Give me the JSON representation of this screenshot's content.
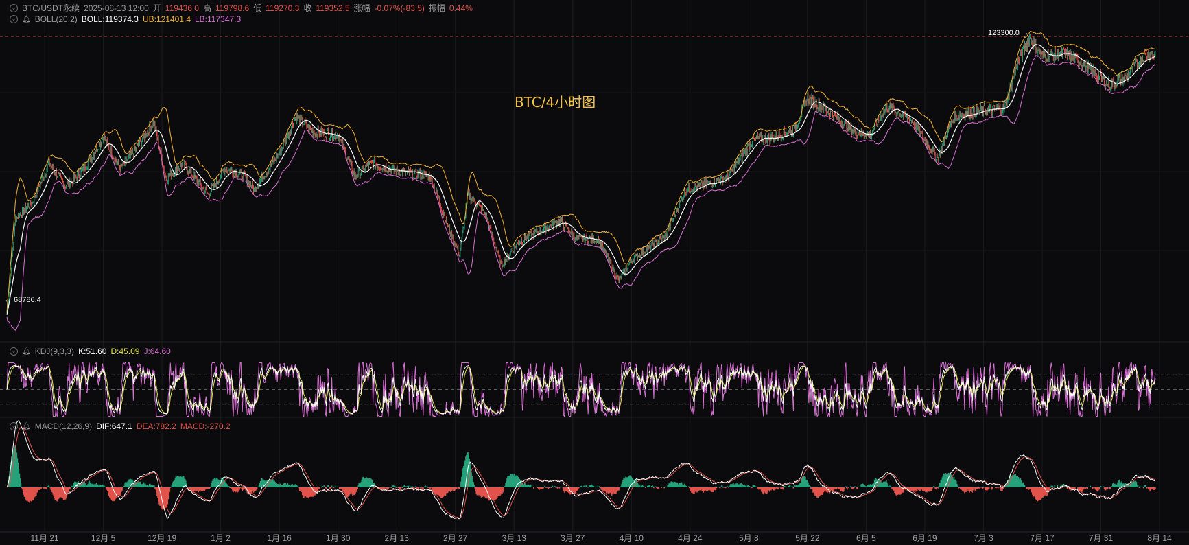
{
  "header": {
    "symbol": "BTC/USDT永续",
    "datetime": "2025-08-13 12:00",
    "open_label": "开",
    "open": "119436.0",
    "high_label": "高",
    "high": "119798.6",
    "low_label": "低",
    "low": "119270.3",
    "close_label": "收",
    "close": "119352.5",
    "change_label": "涨幅",
    "change": "-0.07%(-83.5)",
    "amp_label": "振幅",
    "amp": "0.44%"
  },
  "boll": {
    "name": "BOLL(20,2)",
    "mid": "BOLL:119374.3",
    "ub": "UB:121401.4",
    "lb": "LB:117347.3"
  },
  "kdj": {
    "name": "KDJ(9,3,3)",
    "k": "K:51.60",
    "d": "D:45.09",
    "j": "J:64.60"
  },
  "macd": {
    "name": "MACD(12,26,9)",
    "dif": "DIF:647.1",
    "dea": "DEA:782.2",
    "macd": "MACD:-270.2"
  },
  "annotations": {
    "title": "BTC/4小时图",
    "high_tag": "123300.0 →",
    "low_tag": "← 68786.4"
  },
  "colors": {
    "bg": "#0b0b0d",
    "up": "#26a17b",
    "down": "#e0534a",
    "boll_mid": "#ffffff",
    "boll_ub": "#f2b233",
    "boll_lb": "#d86fd3",
    "kdj_k": "#ffffff",
    "kdj_d": "#e6e34a",
    "kdj_j": "#d86fd3",
    "ref_line": "#e0534a"
  },
  "chart_data": {
    "type": "line",
    "xlabel": "",
    "ylabel": "",
    "x_ticks": [
      "11月 21",
      "12月 5",
      "12月 19",
      "1月 2",
      "1月 16",
      "1月 30",
      "2月 13",
      "2月 27",
      "3月 13",
      "3月 27",
      "4月 10",
      "4月 24",
      "5月 8",
      "5月 22",
      "6月 5",
      "6月 19",
      "7月 3",
      "7月 17",
      "7月 31",
      "8月 14"
    ],
    "price_extremes": {
      "high": 123300.0,
      "low": 68786.4
    },
    "reference_line": 122800,
    "price_ylim": [
      68000,
      124500
    ],
    "price_series": [
      {
        "date": "2024-11-12",
        "close": 69500
      },
      {
        "date": "2024-11-14",
        "close": 88000
      },
      {
        "date": "2024-11-18",
        "close": 91000
      },
      {
        "date": "2024-11-22",
        "close": 98500
      },
      {
        "date": "2024-11-26",
        "close": 94000
      },
      {
        "date": "2024-11-30",
        "close": 97000
      },
      {
        "date": "2024-12-05",
        "close": 103500
      },
      {
        "date": "2024-12-09",
        "close": 97500
      },
      {
        "date": "2024-12-13",
        "close": 101500
      },
      {
        "date": "2024-12-17",
        "close": 106500
      },
      {
        "date": "2024-12-20",
        "close": 95500
      },
      {
        "date": "2024-12-24",
        "close": 98500
      },
      {
        "date": "2024-12-30",
        "close": 92500
      },
      {
        "date": "2025-01-03",
        "close": 97500
      },
      {
        "date": "2025-01-07",
        "close": 96500
      },
      {
        "date": "2025-01-10",
        "close": 93500
      },
      {
        "date": "2025-01-16",
        "close": 100500
      },
      {
        "date": "2025-01-20",
        "close": 107500
      },
      {
        "date": "2025-01-24",
        "close": 104500
      },
      {
        "date": "2025-01-30",
        "close": 104000
      },
      {
        "date": "2025-02-03",
        "close": 96000
      },
      {
        "date": "2025-02-07",
        "close": 98500
      },
      {
        "date": "2025-02-13",
        "close": 97000
      },
      {
        "date": "2025-02-21",
        "close": 96000
      },
      {
        "date": "2025-02-25",
        "close": 87000
      },
      {
        "date": "2025-02-28",
        "close": 81000
      },
      {
        "date": "2025-03-02",
        "close": 92500
      },
      {
        "date": "2025-03-06",
        "close": 89000
      },
      {
        "date": "2025-03-10",
        "close": 79000
      },
      {
        "date": "2025-03-14",
        "close": 83500
      },
      {
        "date": "2025-03-24",
        "close": 87500
      },
      {
        "date": "2025-03-28",
        "close": 84000
      },
      {
        "date": "2025-04-02",
        "close": 84000
      },
      {
        "date": "2025-04-07",
        "close": 76000
      },
      {
        "date": "2025-04-10",
        "close": 80000
      },
      {
        "date": "2025-04-18",
        "close": 84500
      },
      {
        "date": "2025-04-23",
        "close": 93500
      },
      {
        "date": "2025-04-28",
        "close": 94500
      },
      {
        "date": "2025-05-03",
        "close": 96000
      },
      {
        "date": "2025-05-09",
        "close": 103000
      },
      {
        "date": "2025-05-14",
        "close": 103500
      },
      {
        "date": "2025-05-19",
        "close": 105000
      },
      {
        "date": "2025-05-22",
        "close": 111000
      },
      {
        "date": "2025-05-27",
        "close": 108500
      },
      {
        "date": "2025-06-02",
        "close": 104500
      },
      {
        "date": "2025-06-06",
        "close": 104000
      },
      {
        "date": "2025-06-10",
        "close": 109500
      },
      {
        "date": "2025-06-16",
        "close": 106500
      },
      {
        "date": "2025-06-22",
        "close": 99500
      },
      {
        "date": "2025-06-26",
        "close": 107500
      },
      {
        "date": "2025-07-02",
        "close": 108500
      },
      {
        "date": "2025-07-08",
        "close": 109000
      },
      {
        "date": "2025-07-11",
        "close": 117500
      },
      {
        "date": "2025-07-14",
        "close": 122500
      },
      {
        "date": "2025-07-17",
        "close": 119000
      },
      {
        "date": "2025-07-22",
        "close": 119500
      },
      {
        "date": "2025-07-26",
        "close": 118000
      },
      {
        "date": "2025-08-02",
        "close": 113500
      },
      {
        "date": "2025-08-06",
        "close": 115000
      },
      {
        "date": "2025-08-10",
        "close": 119000
      },
      {
        "date": "2025-08-13",
        "close": 119352.5
      }
    ],
    "kdj_ylim": [
      -10,
      110
    ],
    "kdj_levels": [
      20,
      50,
      80
    ],
    "macd_ylim": [
      -3000,
      3500
    ]
  }
}
